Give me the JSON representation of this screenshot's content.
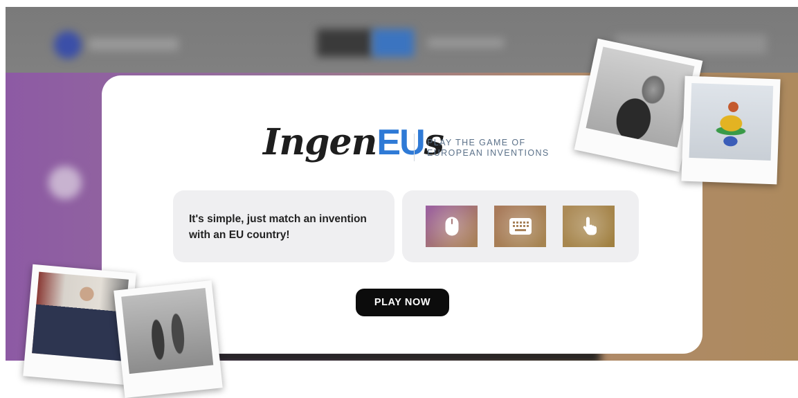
{
  "logo": {
    "prefix": "Ingen",
    "highlight": "EU",
    "suffix": "s"
  },
  "tagline": {
    "line1": "PLAY THE GAME OF",
    "line2": "EUROPEAN INVENTIONS"
  },
  "intro": {
    "text": "It's simple, just match an invention with an EU country!"
  },
  "controls": [
    {
      "icon": "mouse-icon"
    },
    {
      "icon": "keyboard-icon"
    },
    {
      "icon": "touch-icon"
    }
  ],
  "play_button": {
    "label": "PLAY NOW"
  },
  "colors": {
    "eu_blue": "#2f7ad6",
    "button_bg": "#0c0c0c",
    "panel_bg": "#efeff1",
    "tagline": "#5b7189"
  }
}
